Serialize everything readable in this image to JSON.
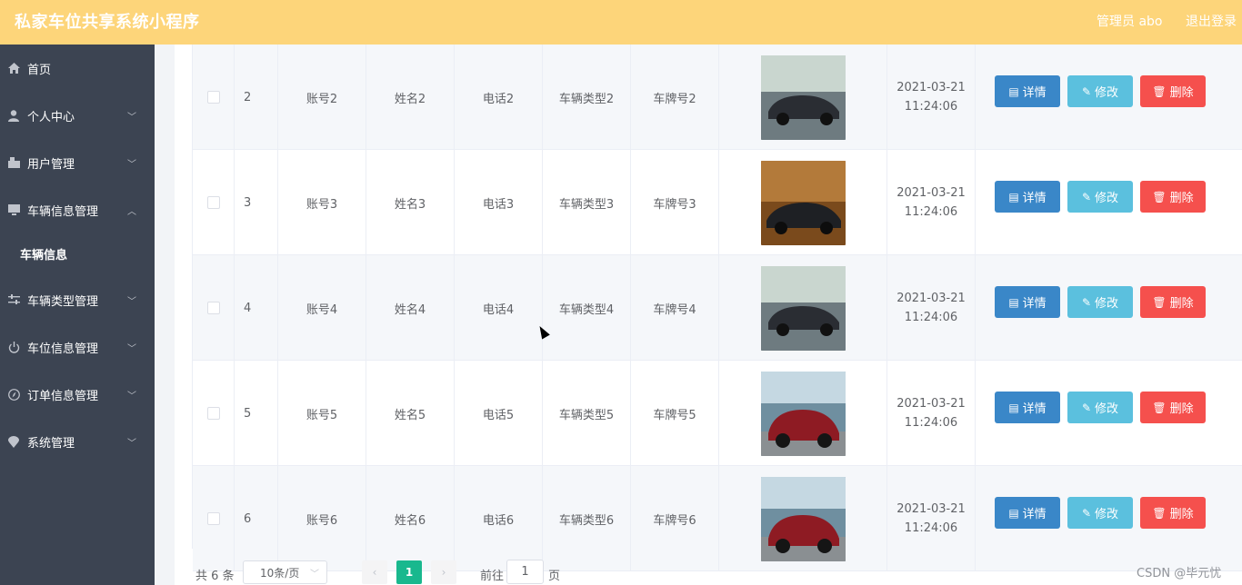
{
  "header": {
    "title": "私家车位共享系统小程序",
    "admin": "管理员 abo",
    "logout": "退出登录",
    "bg_color": "#fdd57a"
  },
  "sidebar": {
    "bg_color": "#3c4452",
    "items": [
      {
        "label": "首页",
        "icon": "home-icon",
        "has_chevron": false
      },
      {
        "label": "个人中心",
        "icon": "user-icon",
        "has_chevron": true
      },
      {
        "label": "用户管理",
        "icon": "users-icon",
        "has_chevron": true
      },
      {
        "label": "车辆信息管理",
        "icon": "monitor-icon",
        "has_chevron": true,
        "expanded": true
      },
      {
        "label": "车辆信息",
        "icon": "",
        "has_chevron": false,
        "sub": true
      },
      {
        "label": "车辆类型管理",
        "icon": "sliders-icon",
        "has_chevron": true
      },
      {
        "label": "车位信息管理",
        "icon": "power-icon",
        "has_chevron": true
      },
      {
        "label": "订单信息管理",
        "icon": "compass-icon",
        "has_chevron": true
      },
      {
        "label": "系统管理",
        "icon": "location-icon",
        "has_chevron": true
      }
    ]
  },
  "table": {
    "rows": [
      {
        "index": "2",
        "account": "账号2",
        "name": "姓名2",
        "phone": "电话2",
        "type": "车辆类型2",
        "plate": "车牌号2",
        "date": "2021-03-21",
        "time": "11:24:06",
        "image": "sedan-dark-car"
      },
      {
        "index": "3",
        "account": "账号3",
        "name": "姓名3",
        "phone": "电话3",
        "type": "车辆类型3",
        "plate": "车牌号3",
        "date": "2021-03-21",
        "time": "11:24:06",
        "image": "sports-car-night"
      },
      {
        "index": "4",
        "account": "账号4",
        "name": "姓名4",
        "phone": "电话4",
        "type": "车辆类型4",
        "plate": "车牌号4",
        "date": "2021-03-21",
        "time": "11:24:06",
        "image": "sedan-dark-car"
      },
      {
        "index": "5",
        "account": "账号5",
        "name": "姓名5",
        "phone": "电话5",
        "type": "车辆类型5",
        "plate": "车牌号5",
        "date": "2021-03-21",
        "time": "11:24:06",
        "image": "red-suv"
      },
      {
        "index": "6",
        "account": "账号6",
        "name": "姓名6",
        "phone": "电话6",
        "type": "车辆类型6",
        "plate": "车牌号6",
        "date": "2021-03-21",
        "time": "11:24:06",
        "image": "red-suv"
      }
    ],
    "buttons": {
      "detail": "详情",
      "edit": "修改",
      "delete": "删除",
      "detail_color": "#3a87c8",
      "edit_color": "#5bc0de",
      "delete_color": "#f5504d"
    }
  },
  "pagination": {
    "total": "共 6 条",
    "page_size": "10条/页",
    "current_page": "1",
    "goto_label": "前往",
    "goto_value": "1",
    "page_unit": "页",
    "active_color": "#19b88e"
  },
  "watermark": "CSDN @毕元忧"
}
